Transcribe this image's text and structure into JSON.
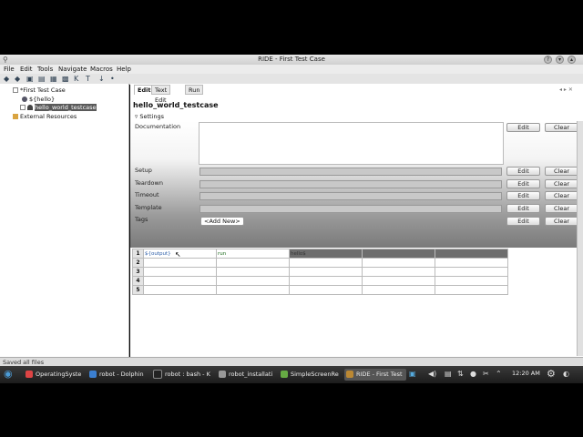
{
  "window": {
    "title": "RIDE - First Test Case"
  },
  "menu": [
    "File",
    "Edit",
    "Tools",
    "Navigate",
    "Macros",
    "Help"
  ],
  "toolbar": {
    "icons": [
      "back-icon",
      "forward-icon",
      "open-icon",
      "folder-icon",
      "save-icon",
      "save-all-icon",
      "search-keyword-icon",
      "run-icon",
      "stop-icon",
      "refresh-icon"
    ]
  },
  "tree": {
    "root": "*First Test Case",
    "var": "${hello}",
    "testcase": "hello_world_testcase",
    "external": "External Resources"
  },
  "tabs": [
    "Edit",
    "Text Edit",
    "Run"
  ],
  "editor": {
    "name": "hello_world_testcase",
    "settings_label": "Settings",
    "documentation_label": "Documentation",
    "setup_label": "Setup",
    "teardown_label": "Teardown",
    "timeout_label": "Timeout",
    "template_label": "Template",
    "tags_label": "Tags",
    "edit": "Edit",
    "clear": "Clear",
    "add_new": "<Add New>"
  },
  "grid": {
    "rows": [
      "1",
      "2",
      "3",
      "4",
      "5"
    ],
    "row1": [
      "${output}",
      "run",
      "hello$"
    ]
  },
  "status": "Saved all files",
  "taskbar": {
    "items": [
      "OperatingSyste",
      "robot - Dolphin",
      "robot : bash - K",
      "robot_installati",
      "SimpleScreenRe",
      "RIDE - First Test"
    ],
    "clock": "12:20 AM"
  }
}
